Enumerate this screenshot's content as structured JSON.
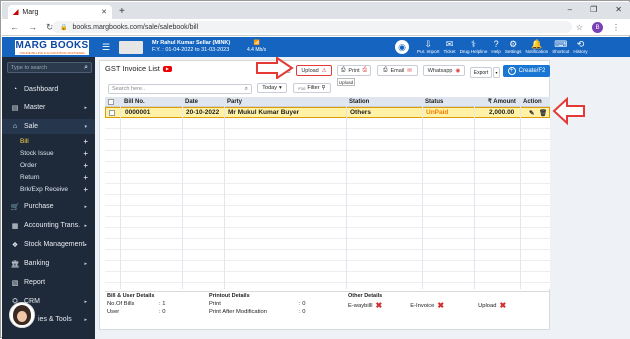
{
  "browser": {
    "tab_title": "Marg",
    "tab_favicon": "marg-favicon",
    "url": "books.margbooks.com/sale/salebook/bill",
    "profile_initial": "B"
  },
  "header": {
    "logo_main": "MARG BOOKS",
    "logo_sub": "ONLINE BILLING & ACCOUNTING SOFTWARE",
    "org_name": "Mr Rahul Kumar Sellar (MINK)",
    "fy": "F.Y. : 01-04-2022 to 31-03-2023",
    "speed": "4.4 Mb/s",
    "tools": [
      {
        "label": "Pur. Import",
        "icon": "import-icon"
      },
      {
        "label": "Ticket",
        "icon": "ticket-icon"
      },
      {
        "label": "Drug Helpline",
        "icon": "drug-icon"
      },
      {
        "label": "Help",
        "icon": "help-icon"
      },
      {
        "label": "Settings",
        "icon": "gear-icon"
      },
      {
        "label": "Notification",
        "icon": "bell-icon"
      },
      {
        "label": "Shortcut",
        "icon": "keyboard-icon"
      },
      {
        "label": "History",
        "icon": "history-icon"
      }
    ],
    "notification_count": "21"
  },
  "sidebar": {
    "search_placeholder": "Type to search",
    "items": [
      {
        "label": "Dashboard",
        "icon": "dashboard-icon"
      },
      {
        "label": "Master",
        "icon": "master-icon"
      },
      {
        "label": "Sale",
        "icon": "sale-icon"
      },
      {
        "label": "Purchase",
        "icon": "cart-icon"
      },
      {
        "label": "Accounting Trans.",
        "icon": "accounting-icon"
      },
      {
        "label": "Stock Management",
        "icon": "stock-icon"
      },
      {
        "label": "Banking",
        "icon": "bank-icon"
      },
      {
        "label": "Report",
        "icon": "report-icon"
      },
      {
        "label": "CRM",
        "icon": "crm-icon"
      },
      {
        "label": "ies & Tools",
        "icon": "tools-icon"
      }
    ],
    "sale_sub": [
      "Bill",
      "Stock Issue",
      "Order",
      "Return",
      "Brk/Exp Receive"
    ]
  },
  "page": {
    "title": "GST Invoice List",
    "upload": "Upload",
    "upload_tooltip": "Upload",
    "print": "Print",
    "email": "Email",
    "whatsapp": "Whatsapp",
    "export": "Export",
    "create": "Create/F2",
    "search_placeholder": "Search here..",
    "date_filter": "Today",
    "filter": "Filter",
    "filter_key": "F10"
  },
  "table": {
    "headers": [
      "Bill No.",
      "Date",
      "Party",
      "Station",
      "Status",
      "₹ Amount",
      "Action"
    ],
    "rows": [
      {
        "bill_no": "0000001",
        "date": "20-10-2022",
        "party": "Mr Mukul Kumar Buyer",
        "station": "Others",
        "status": "UnPaid",
        "amount": "2,000.00"
      }
    ]
  },
  "footer": {
    "bill_user": {
      "title": "Bill & User Details",
      "no_of_bills_label": "No.Of Bills",
      "no_of_bills": "1",
      "user_label": "User",
      "user": "0"
    },
    "printout": {
      "title": "Printout Details",
      "print_label": "Print",
      "print": "0",
      "after_mod_label": "Print After Modification",
      "after_mod": "0"
    },
    "other": {
      "title": "Other Details",
      "ewaybill": "E-waybilll",
      "einvoice": "E-Invoice",
      "upload": "Upload"
    }
  },
  "colors": {
    "header_blue": "#1565c0",
    "sidebar": "#1e2a3a",
    "highlight_row": "#fff2a6",
    "annotation_red": "#e53935"
  }
}
